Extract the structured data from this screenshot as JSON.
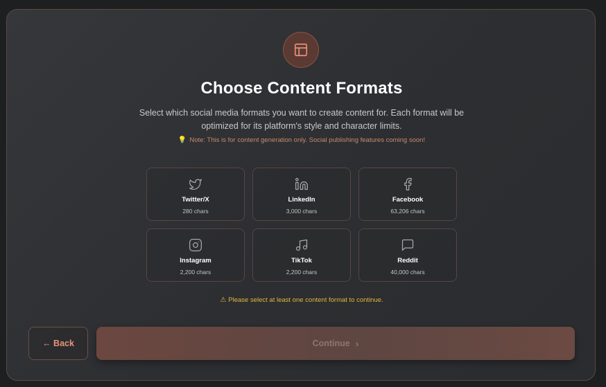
{
  "header": {
    "icon": "layout-icon",
    "title": "Choose Content Formats",
    "subtitle": "Select which social media formats you want to create content for. Each format will be optimized for its platform's style and character limits.",
    "note": "Note: This is for content generation only. Social publishing features coming soon!",
    "note_icon": "lightbulb-icon"
  },
  "formats": [
    {
      "name": "Twitter/X",
      "chars": "280 chars",
      "icon": "twitter-icon"
    },
    {
      "name": "LinkedIn",
      "chars": "3,000 chars",
      "icon": "linkedin-icon"
    },
    {
      "name": "Facebook",
      "chars": "63,206 chars",
      "icon": "facebook-icon"
    },
    {
      "name": "Instagram",
      "chars": "2,200 chars",
      "icon": "instagram-icon"
    },
    {
      "name": "TikTok",
      "chars": "2,200 chars",
      "icon": "music-note-icon"
    },
    {
      "name": "Reddit",
      "chars": "40,000 chars",
      "icon": "message-square-icon"
    }
  ],
  "warning": {
    "text": "Please select at least one content format to continue.",
    "icon": "warning-triangle-icon",
    "color": "#e0b83c"
  },
  "actions": {
    "back_label": "← Back",
    "continue_label": "Continue",
    "continue_icon": "chevron-right-icon",
    "continue_disabled": true
  },
  "colors": {
    "accent": "#e49377",
    "card_border": "#5a4a45",
    "background": "#2c2e31"
  }
}
